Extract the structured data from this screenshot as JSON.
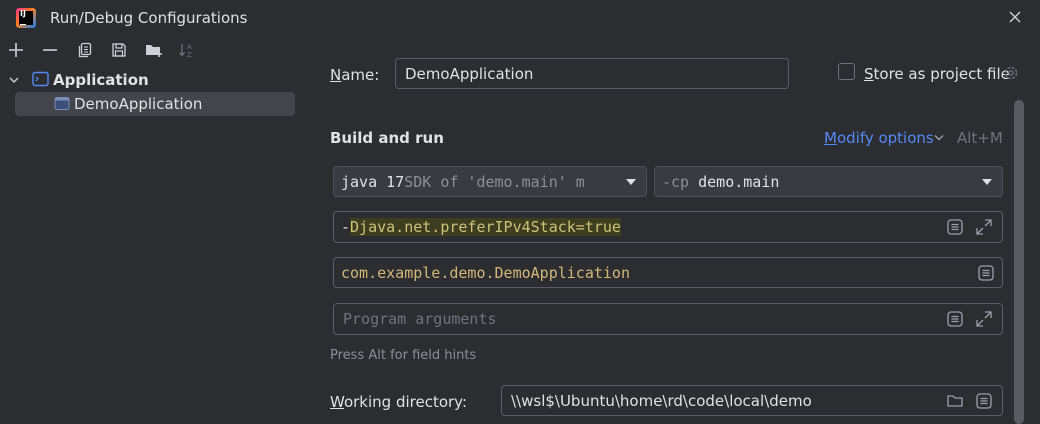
{
  "window": {
    "title": "Run/Debug Configurations"
  },
  "tree": {
    "group_label": "Application",
    "items": [
      {
        "label": "DemoApplication"
      }
    ]
  },
  "form": {
    "name_label": "Name:",
    "name_value": "DemoApplication",
    "store_label": "Store as project file",
    "store_checked": false,
    "section_title": "Build and run",
    "modify_label": "Modify options",
    "modify_shortcut": "Alt+M",
    "jdk_strong": "java 17",
    "jdk_dim": " SDK of 'demo.main' m",
    "cp_prefix": "-cp",
    "cp_value": "demo.main",
    "vm_options_dash": "-",
    "vm_options_value": "Djava.net.preferIPv4Stack=true",
    "main_class": "com.example.demo.DemoApplication",
    "program_args_placeholder": "Program arguments",
    "hint": "Press Alt for field hints",
    "workdir_label": "Working directory:",
    "workdir_value": "\\\\wsl$\\Ubuntu\\home\\rd\\code\\local\\demo"
  },
  "colors": {
    "accent": "#548af7",
    "main_class_color": "#d5b778",
    "vm_highlight_bg": "#3f3d1f",
    "vm_text": "#cbc37d"
  }
}
